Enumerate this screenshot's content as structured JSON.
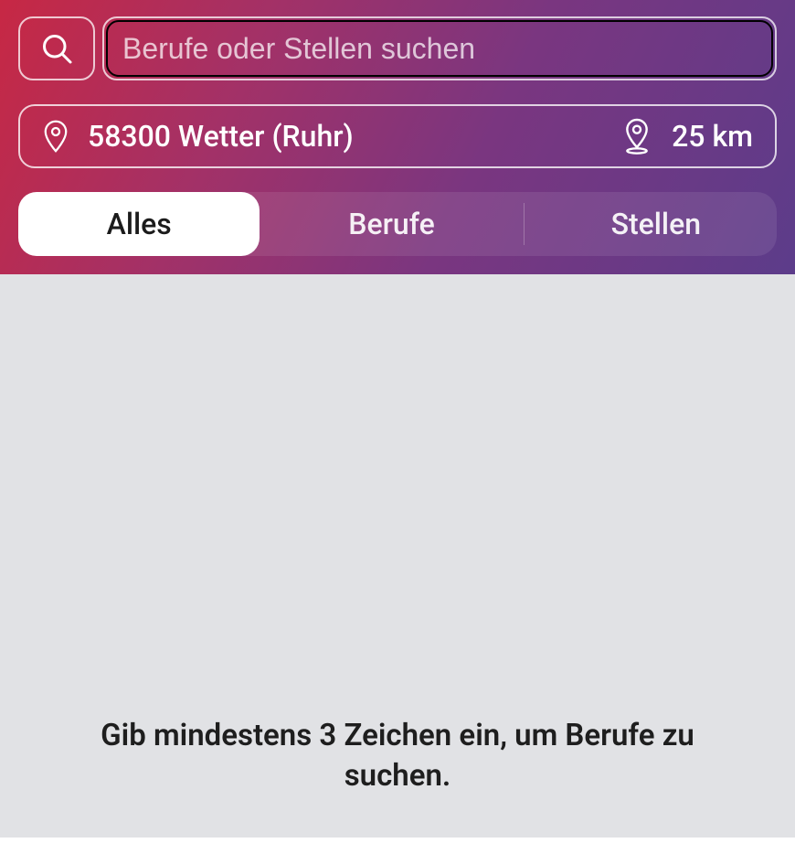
{
  "search": {
    "placeholder": "Berufe oder Stellen suchen",
    "value": ""
  },
  "location": {
    "value": "58300 Wetter (Ruhr)",
    "distance": "25 km"
  },
  "tabs": {
    "all": "Alles",
    "jobs": "Berufe",
    "positions": "Stellen",
    "active_index": 0
  },
  "content": {
    "hint": "Gib mindestens 3 Zeichen ein, um Berufe zu suchen."
  }
}
